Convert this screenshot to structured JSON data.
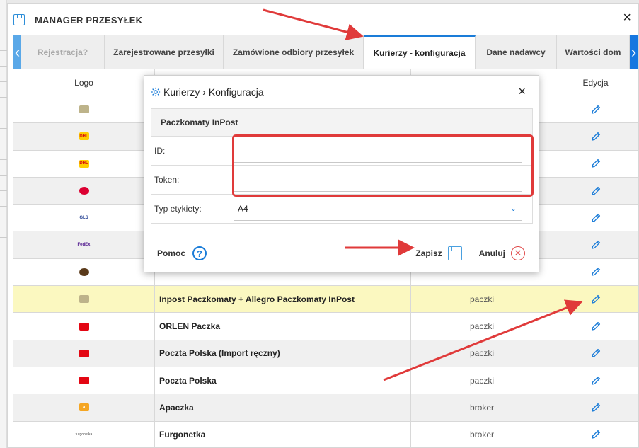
{
  "window": {
    "title": "MANAGER PRZESYŁEK",
    "close": "×"
  },
  "tabs": [
    {
      "label": "Rejestracja?",
      "state": "inactive",
      "width": 118
    },
    {
      "label": "Zarejestrowane przesyłki",
      "state": "normal",
      "width": 168
    },
    {
      "label": "Zamówione odbiory przesyłek",
      "state": "normal",
      "width": 198
    },
    {
      "label": "Kurierzy - konfiguracja",
      "state": "active",
      "width": 158
    },
    {
      "label": "Dane nadawcy",
      "state": "normal",
      "width": 115
    },
    {
      "label": "Wartości dom",
      "state": "normal",
      "width": 103
    }
  ],
  "table": {
    "headers": {
      "logo": "Logo",
      "edit": "Edycja"
    },
    "rows": [
      {
        "name": "",
        "type": "",
        "logo": "inpost"
      },
      {
        "name": "",
        "type": "",
        "logo": "dhl"
      },
      {
        "name": "",
        "type": "",
        "logo": "dhl"
      },
      {
        "name": "",
        "type": "",
        "logo": "dpd"
      },
      {
        "name": "",
        "type": "",
        "logo": "gls"
      },
      {
        "name": "",
        "type": "",
        "logo": "fedex"
      },
      {
        "name": "",
        "type": "",
        "logo": "ups"
      },
      {
        "name": "Inpost Paczkomaty + Allegro Paczkomaty InPost",
        "type": "paczki",
        "logo": "inpost"
      },
      {
        "name": "ORLEN Paczka",
        "type": "paczki",
        "logo": "orlen"
      },
      {
        "name": "Poczta Polska (Import ręczny)",
        "type": "paczki",
        "logo": "poczta"
      },
      {
        "name": "Poczta Polska",
        "type": "paczki",
        "logo": "poczta"
      },
      {
        "name": "Apaczka",
        "type": "broker",
        "logo": "apaczka"
      },
      {
        "name": "Furgonetka",
        "type": "broker",
        "logo": "furgonetka"
      }
    ]
  },
  "modal": {
    "title": "Kurierzy › Konfiguracja",
    "close": "×",
    "section": "Paczkomaty InPost",
    "fields": {
      "id_label": "ID:",
      "id_value": "",
      "token_label": "Token:",
      "token_value": "",
      "label_type_label": "Typ etykiety:",
      "label_type_value": "A4"
    },
    "help_label": "Pomoc",
    "save_label": "Zapisz",
    "cancel_label": "Anuluj"
  },
  "colors": {
    "accent": "#1a7cd8",
    "annotation": "#e03a3a",
    "highlight": "#fbf8c0"
  }
}
